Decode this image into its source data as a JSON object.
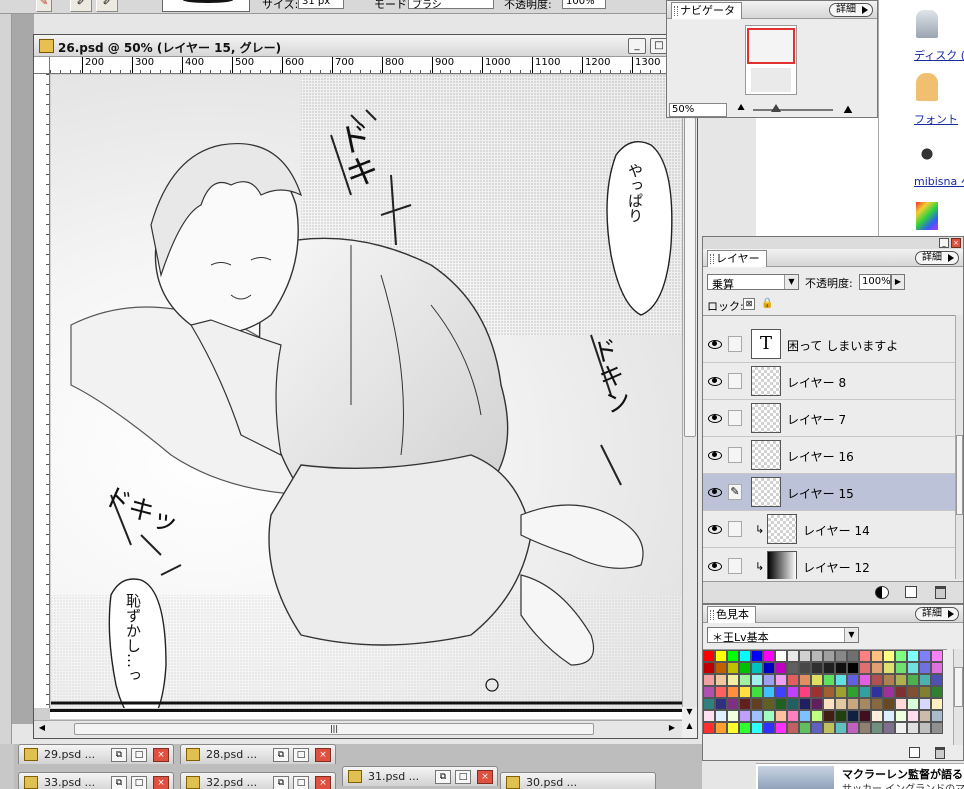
{
  "toolbar": {
    "size_label": "サイズ:",
    "size_value": "31 px",
    "mode_label": "モード:",
    "mode_value": "ブラシ",
    "opacity_label": "不透明度:",
    "opacity_value": "100%"
  },
  "document": {
    "title": "26.psd @ 50% (レイヤー 15, グレー)",
    "ruler_marks": [
      "200",
      "300",
      "400",
      "500",
      "600",
      "700",
      "800",
      "900",
      "1000",
      "1100",
      "1200",
      "1300"
    ],
    "bubble_top": "やっぱり",
    "bubble_bottom": "恥ずかし…っ",
    "sfx_1": "ドキ",
    "sfx_2": "ドキン",
    "sfx_3": "ドキッ"
  },
  "navigator": {
    "tab": "ナビゲータ",
    "detail": "詳細",
    "zoom": "50%"
  },
  "layers": {
    "tab": "レイヤー",
    "detail": "詳細",
    "blend_mode": "乗算",
    "opacity_label": "不透明度:",
    "opacity_value": "100%",
    "lock_label": "ロック:",
    "items": [
      {
        "name": "困って しまいますよ",
        "type": "text"
      },
      {
        "name": "レイヤー 8",
        "type": "raster"
      },
      {
        "name": "レイヤー 7",
        "type": "raster"
      },
      {
        "name": "レイヤー 16",
        "type": "raster"
      },
      {
        "name": "レイヤー 15",
        "type": "raster",
        "selected": true
      },
      {
        "name": "レイヤー 14",
        "type": "clipped"
      },
      {
        "name": "レイヤー 12",
        "type": "gradient"
      }
    ],
    "text_thumb_glyph": "T"
  },
  "swatches": {
    "tab": "色見本",
    "detail": "詳細",
    "library": "＊王Lv基本",
    "colors": [
      "#ff0000",
      "#ffff00",
      "#00ff00",
      "#00ffff",
      "#0000ff",
      "#ff00ff",
      "#ffffff",
      "#e8e8e8",
      "#d0d0d0",
      "#b8b8b8",
      "#a0a0a0",
      "#888888",
      "#707070",
      "#ff8080",
      "#ffc080",
      "#ffff80",
      "#80ff80",
      "#80ffff",
      "#8080ff",
      "#ff80ff",
      "#c00000",
      "#c06000",
      "#c0c000",
      "#00c000",
      "#00c0c0",
      "#0000c0",
      "#c000c0",
      "#606060",
      "#484848",
      "#303030",
      "#202020",
      "#101010",
      "#000000",
      "#e07070",
      "#e0a070",
      "#e0e070",
      "#70e070",
      "#70e0e0",
      "#7070e0",
      "#e070e0",
      "#f0a0a0",
      "#f0c8a0",
      "#f0f0a0",
      "#a0f0a0",
      "#a0f0f0",
      "#a0a0f0",
      "#f0a0f0",
      "#e06060",
      "#e09060",
      "#e0e060",
      "#60e060",
      "#60e0e0",
      "#6060e0",
      "#e060e0",
      "#b05050",
      "#b08050",
      "#b0b050",
      "#50b050",
      "#50b0b0",
      "#5050b0",
      "#b050b0",
      "#ff6060",
      "#ff9040",
      "#ffe040",
      "#40e040",
      "#40c0ff",
      "#4040ff",
      "#c040ff",
      "#ff4080",
      "#a03030",
      "#a06030",
      "#a0a030",
      "#30a030",
      "#30a0a0",
      "#3030a0",
      "#a030a0",
      "#803030",
      "#805030",
      "#808030",
      "#308030",
      "#308080",
      "#303080",
      "#803080",
      "#602020",
      "#604020",
      "#606020",
      "#206020",
      "#206060",
      "#202060",
      "#602060",
      "#f8e0c0",
      "#e0c8a0",
      "#c8a880",
      "#a88860",
      "#886840",
      "#684820",
      "#ffd8d8",
      "#d8ffd8",
      "#d8d8ff",
      "#fff0c0",
      "#ffe0f0",
      "#e0f0ff",
      "#f0ffe0",
      "#c0a0ff",
      "#a0c0ff",
      "#a0ffc0",
      "#ffc0a0",
      "#ff80c0",
      "#80c0ff",
      "#c0ff80",
      "#402010",
      "#204010",
      "#102040",
      "#401020",
      "#ffeedd",
      "#ddeeff",
      "#eeffdd",
      "#ffddee",
      "#ccbbaa",
      "#aabbcc",
      "#ff3030",
      "#ffa030",
      "#ffff30",
      "#30ff30",
      "#30ffff",
      "#3030ff",
      "#ff30ff",
      "#c06060",
      "#60c060",
      "#6060c0",
      "#c0c060",
      "#60c0c0",
      "#c060c0",
      "#908070",
      "#709080",
      "#807090",
      "#f0f0f0",
      "#e0e0e0",
      "#c0c0c0",
      "#909090"
    ]
  },
  "taskbar": {
    "docs": [
      "29.psd ...",
      "28.psd ...",
      "33.psd ...",
      "32.psd ...",
      "31.psd ...",
      "30.psd ..."
    ]
  },
  "desktop": {
    "icons": [
      "ディスク (D)",
      "フォント",
      "mibisna へのショートカット"
    ]
  },
  "news": {
    "headline": "マクラーレン監督が語る",
    "sub": "サッカー イングランドのマク"
  }
}
